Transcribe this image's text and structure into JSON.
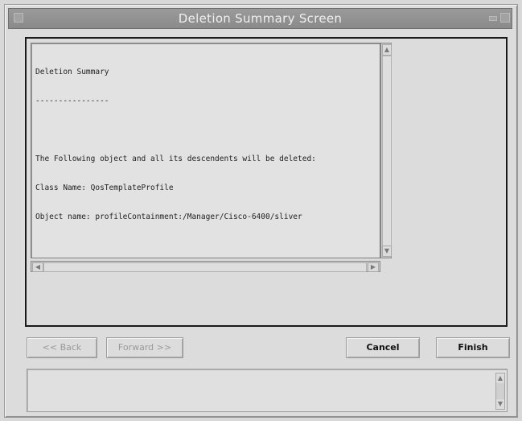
{
  "window": {
    "title": "Deletion Summary Screen"
  },
  "summary": {
    "lines": [
      "Deletion Summary",
      "----------------",
      "",
      "The Following object and all its descendents will be deleted:",
      "Class Name: QosTemplateProfile",
      "Object name: profileContainment:/Manager/Cisco-6400/sliver"
    ]
  },
  "buttons": {
    "back_label": "<< Back",
    "forward_label": "Forward >>",
    "cancel_label": "Cancel",
    "finish_label": "Finish"
  },
  "icons": {
    "scroll_up": "▲",
    "scroll_down": "▼",
    "scroll_left": "◀",
    "scroll_right": "▶"
  },
  "colors": {
    "title_bar": "#8f8f8f",
    "window_bg": "#dcdcdc",
    "frame_border": "#1a1a1a"
  }
}
